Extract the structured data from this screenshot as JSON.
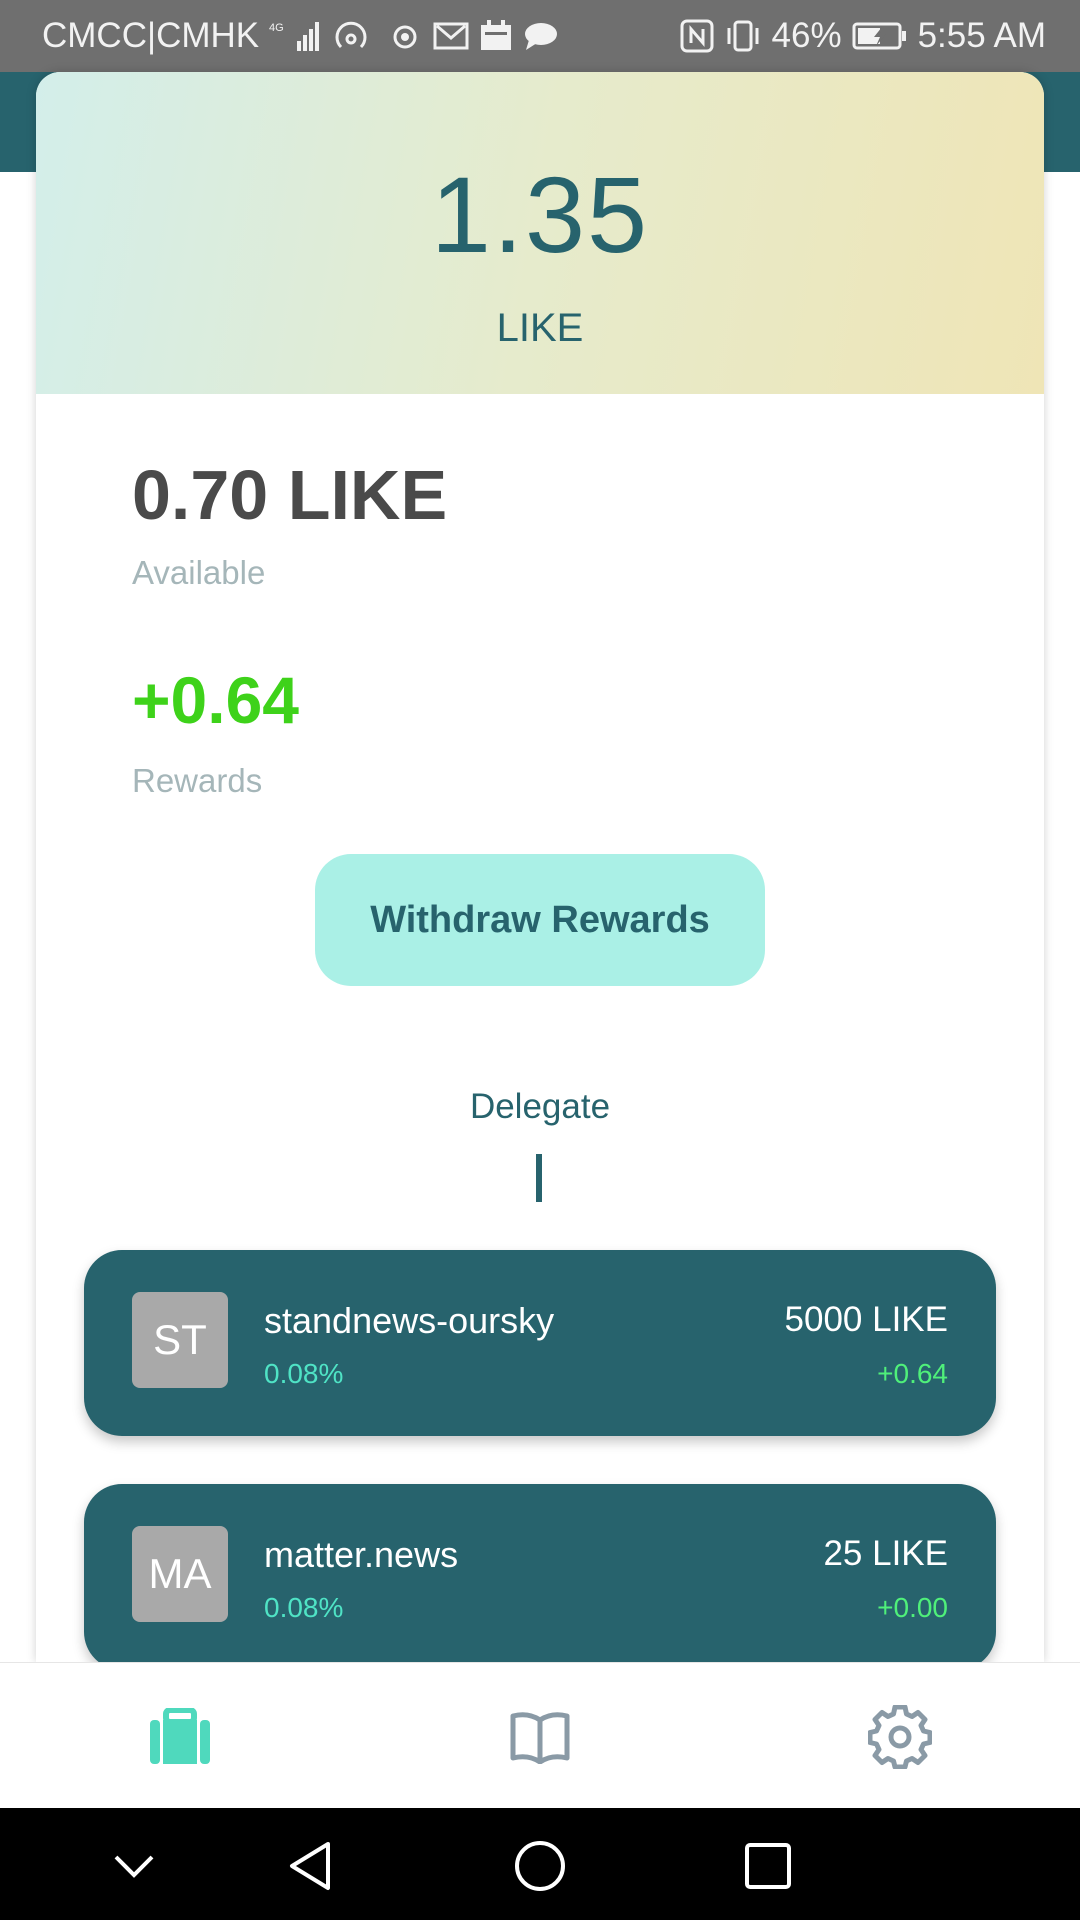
{
  "status_bar": {
    "carrier": "CMCC|CMHK",
    "network_label": "4G",
    "battery": "46%",
    "time": "5:55 AM"
  },
  "wallet": {
    "total_balance": "1.35",
    "total_unit": "LIKE",
    "available_amount": "0.70 LIKE",
    "available_label": "Available",
    "rewards_amount": "+0.64",
    "rewards_label": "Rewards",
    "withdraw_label": "Withdraw Rewards"
  },
  "delegate_section": {
    "title": "Delegate",
    "items": [
      {
        "avatar": "ST",
        "name": "standnews-oursky",
        "rate": "0.08%",
        "amount": "5000 LIKE",
        "reward": "+0.64"
      },
      {
        "avatar": "MA",
        "name": "matter.news",
        "rate": "0.08%",
        "amount": "25 LIKE",
        "reward": "+0.00"
      }
    ]
  },
  "tabs": [
    {
      "icon": "briefcase-icon",
      "active": true
    },
    {
      "icon": "book-icon",
      "active": false
    },
    {
      "icon": "gear-icon",
      "active": false
    }
  ],
  "colors": {
    "brand_teal": "#27636d",
    "accent_mint": "#aaf0e6",
    "reward_green": "#3ed21a",
    "active_tab": "#4fd9bd",
    "inactive_tab": "#8a9aa6"
  }
}
